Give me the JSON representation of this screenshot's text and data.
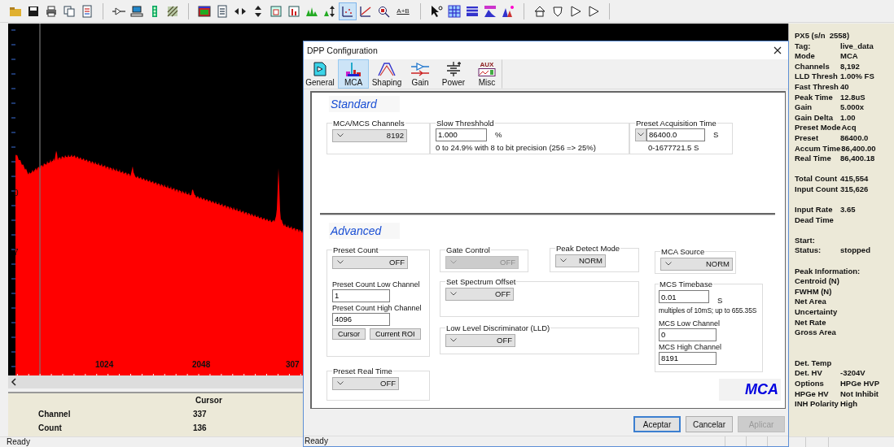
{
  "toolbar": {
    "sum_label": "A+B",
    "points_view_pressed": true
  },
  "spectrum": {
    "y_labels": [
      "0",
      "7"
    ],
    "x_labels": [
      "1024",
      "2048",
      "307"
    ]
  },
  "cursor_panel": {
    "header": "Cursor",
    "rows": [
      {
        "label": "Channel",
        "value": "337"
      },
      {
        "label": "Count",
        "value": "136"
      }
    ]
  },
  "info_panel": {
    "groups": [
      [
        {
          "label": "PX5 (s/n  2558)"
        },
        {
          "label": "Tag:",
          "value": "live_data"
        },
        {
          "label": "Mode",
          "value": "MCA"
        },
        {
          "label": "Channels",
          "value": "8,192"
        },
        {
          "label": "LLD Thresh",
          "value": "1.00% FS"
        },
        {
          "label": "Fast Thresh",
          "value": "40"
        },
        {
          "label": "Peak Time",
          "value": "12.8uS"
        },
        {
          "label": "Gain",
          "value": "5.000x"
        },
        {
          "label": "Gain Delta",
          "value": "1.00"
        },
        {
          "label": "Preset Mode",
          "value": "Acq"
        },
        {
          "label": "Preset",
          "value": "86400.0"
        },
        {
          "label": "Accum Time",
          "value": "86,400.00"
        },
        {
          "label": "Real Time",
          "value": "86,400.18"
        }
      ],
      [
        {
          "label": "Total Count",
          "value": "415,554"
        },
        {
          "label": "Input Count",
          "value": "315,626"
        }
      ],
      [
        {
          "label": "Input Rate",
          "value": "3.65"
        },
        {
          "label": "Dead Time"
        }
      ],
      [
        {
          "label": "Start:"
        },
        {
          "label": "Status:",
          "value": "stopped"
        }
      ],
      [
        {
          "label": "Peak Information:"
        },
        {
          "label": "Centroid (N)"
        },
        {
          "label": "FWHM (N)"
        },
        {
          "label": "Net Area"
        },
        {
          "label": "Uncertainty"
        },
        {
          "label": "Net Rate"
        },
        {
          "label": "Gross Area"
        }
      ],
      [
        {
          "label": "Det. Temp"
        },
        {
          "label": "Det. HV",
          "value": "-3204V"
        },
        {
          "label": "Options",
          "value": "HPGe HVP"
        },
        {
          "label": "HPGe HV",
          "value": "Not Inhibit"
        },
        {
          "label": "INH Polarity",
          "value": "High"
        }
      ]
    ]
  },
  "status_bar": "Ready",
  "dialog": {
    "title": "DPP Configuration",
    "tabs": [
      {
        "label": "General",
        "kind": "general",
        "selected": false
      },
      {
        "label": "MCA",
        "kind": "mca",
        "selected": true
      },
      {
        "label": "Shaping",
        "kind": "shaping",
        "selected": false
      },
      {
        "label": "Gain",
        "kind": "gain",
        "selected": false
      },
      {
        "label": "Power",
        "kind": "power",
        "selected": false
      },
      {
        "label": "Misc",
        "kind": "misc",
        "icon_text": "AUX",
        "selected": false
      }
    ],
    "standard": {
      "title": "Standard",
      "channels": {
        "label": "MCA/MCS Channels",
        "combo": {
          "value": "8192",
          "disabled": false
        }
      },
      "slow_threshold": {
        "label": "Slow Threshhold",
        "value": "1.000",
        "unit": "%",
        "hint": "0 to 24.9% with 8 to bit precision (256 => 25%)"
      },
      "preset_time": {
        "label": "Preset Acquisition Time",
        "value": "86400.0",
        "unit": "S",
        "range": "0-1677721.5 S"
      }
    },
    "advanced": {
      "title": "Advanced",
      "preset_count": {
        "label": "Preset Count",
        "combo": {
          "value": "OFF",
          "disabled": false
        },
        "low_label": "Preset Count Low Channel",
        "low_value": "1",
        "high_label": "Preset Count High Channel",
        "high_value": "4096",
        "buttons": [
          "Cursor",
          "Current ROI"
        ]
      },
      "preset_real_time": {
        "label": "Preset Real Time",
        "combo": {
          "value": "OFF",
          "disabled": false
        }
      },
      "gate_control": {
        "label": "Gate Control",
        "combo": {
          "value": "OFF",
          "disabled": true
        }
      },
      "peak_detect_mode": {
        "label": "Peak Detect Mode",
        "combo": {
          "value": "NORM",
          "disabled": false
        }
      },
      "spectrum_offset": {
        "label": "Set Spectrum Offset",
        "combo": {
          "value": "OFF",
          "disabled": false
        }
      },
      "lld": {
        "label": "Low Level Discriminator (LLD)",
        "combo": {
          "value": "OFF",
          "disabled": false
        }
      },
      "mca_source": {
        "label": "MCA Source",
        "combo": {
          "value": "NORM",
          "disabled": false
        }
      },
      "mcs_timebase": {
        "label": "MCS Timebase",
        "value": "0.01",
        "unit": "S",
        "hint": "multiples of 10mS; up to 655.35S",
        "low_label": "MCS Low Channel",
        "low_value": "0",
        "high_label": "MCS High Channel",
        "high_value": "8191"
      }
    },
    "mode_badge": "MCA",
    "buttons": [
      {
        "label": "Aceptar",
        "kind": "default"
      },
      {
        "label": "Cancelar",
        "kind": "normal"
      },
      {
        "label": "Aplicar",
        "kind": "disabled"
      }
    ],
    "status": "Ready"
  }
}
